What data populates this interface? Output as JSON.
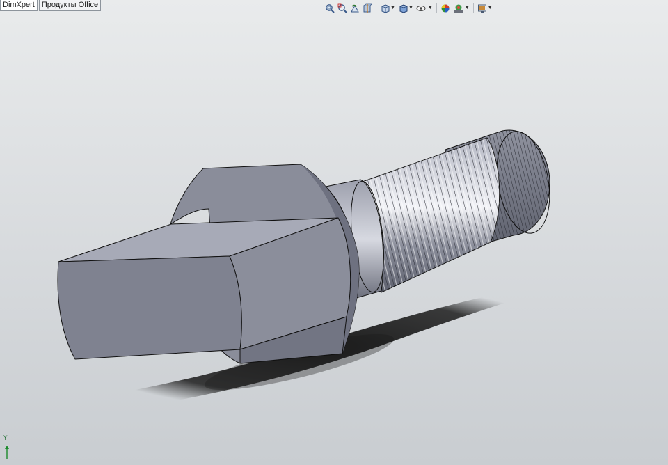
{
  "tabs": [
    {
      "label": "DimXpert",
      "active": true
    },
    {
      "label": "Продукты Office",
      "active": false
    }
  ],
  "heads_up_toolbar": [
    {
      "name": "zoom-to-fit-icon",
      "dropdown": false
    },
    {
      "name": "zoom-to-area-icon",
      "dropdown": false
    },
    {
      "name": "previous-view-icon",
      "dropdown": false
    },
    {
      "name": "section-view-icon",
      "dropdown": false
    },
    {
      "name": "view-orientation-icon",
      "dropdown": true
    },
    {
      "name": "display-style-icon",
      "dropdown": true
    },
    {
      "name": "hide-show-items-icon",
      "dropdown": true
    },
    {
      "name": "edit-appearance-icon",
      "dropdown": false
    },
    {
      "name": "apply-scene-icon",
      "dropdown": true
    },
    {
      "name": "view-settings-icon",
      "dropdown": true
    }
  ],
  "triad": {
    "axis_label": "Y"
  },
  "colors": {
    "part_face": "#7d808e",
    "part_light": "#a3a6b3",
    "part_dark": "#5f6270",
    "edge": "#111111",
    "shadow": "#1e1e1e",
    "background": "#dfe2e4"
  }
}
